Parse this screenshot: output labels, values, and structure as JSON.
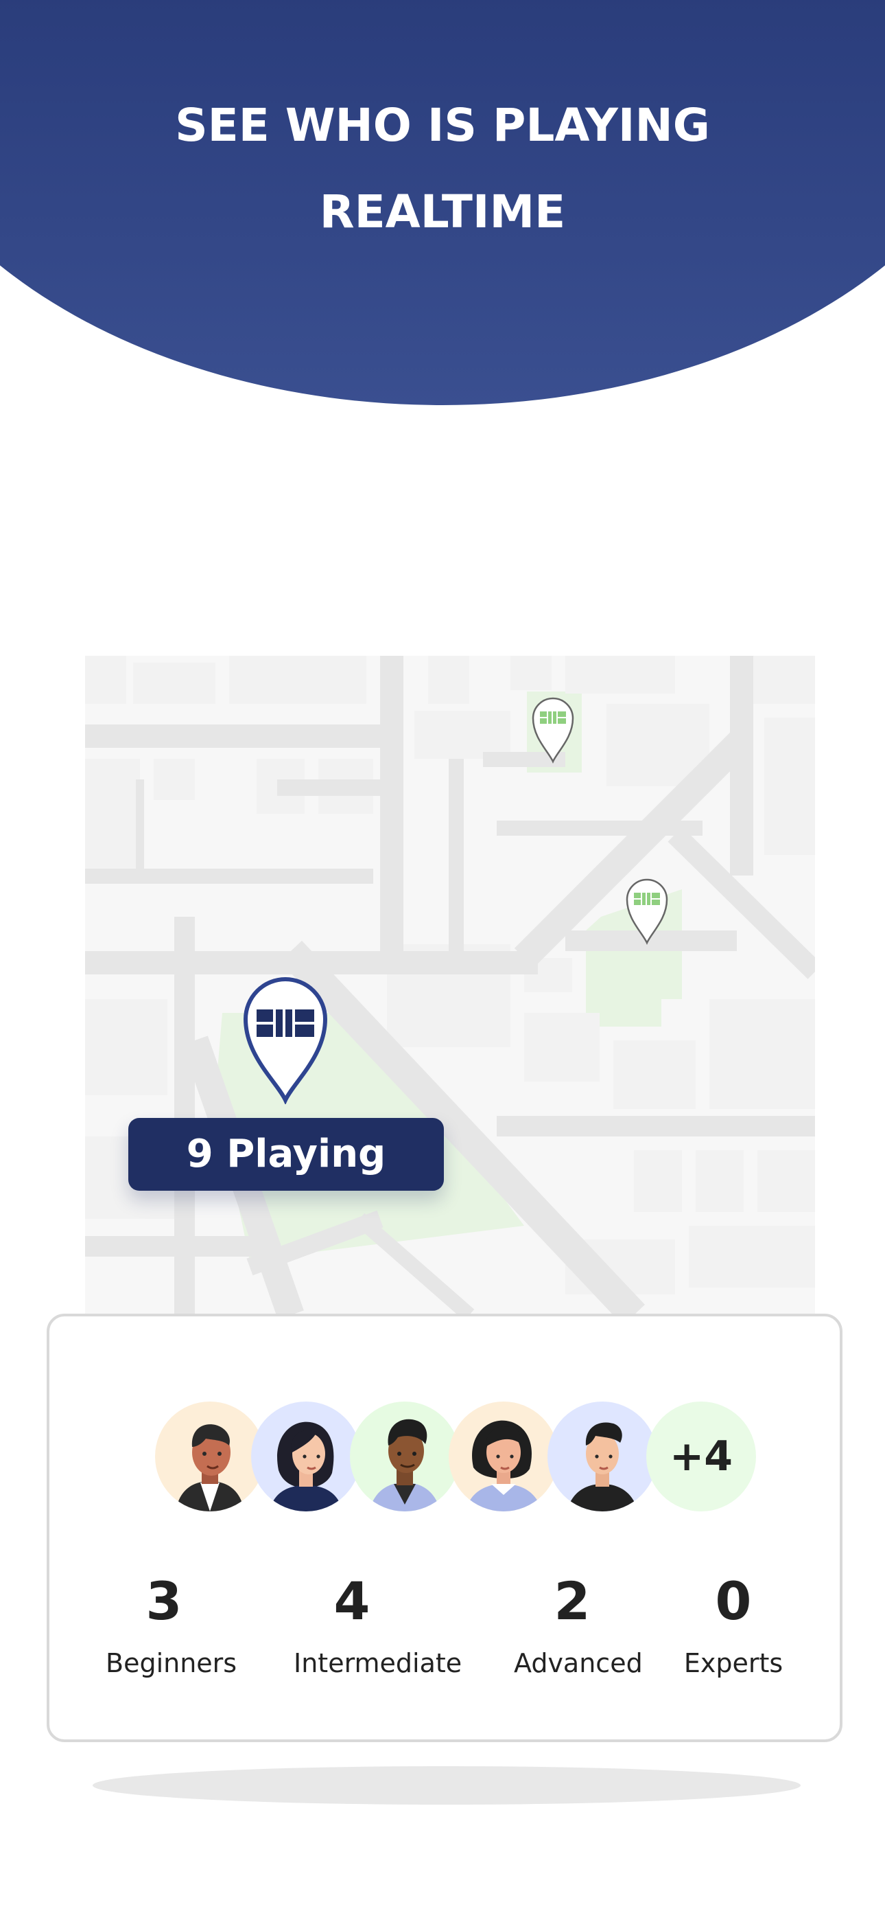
{
  "header": {
    "title_line1": "SEE WHO IS PLAYING",
    "title_line2": "REALTIME"
  },
  "map": {
    "main_marker": {
      "icon": "court-icon",
      "playing_label": "9 Playing"
    },
    "other_markers": [
      {
        "icon": "court-icon"
      },
      {
        "icon": "court-icon"
      }
    ]
  },
  "players_card": {
    "avatars": [
      {
        "name": "avatar-1",
        "background": "#fdeed8"
      },
      {
        "name": "avatar-2",
        "background": "#dfe6ff"
      },
      {
        "name": "avatar-3",
        "background": "#e6fbe2"
      },
      {
        "name": "avatar-4",
        "background": "#fdeed8"
      },
      {
        "name": "avatar-5",
        "background": "#dfe6ff"
      }
    ],
    "more_count": "+4",
    "stats": [
      {
        "value": "3",
        "label": "Beginners"
      },
      {
        "value": "4",
        "label": "Intermediate"
      },
      {
        "value": "2",
        "label": "Advanced"
      },
      {
        "value": "0",
        "label": "Experts"
      }
    ]
  },
  "colors": {
    "brand_navy": "#202f63",
    "court_green": "#8fcf7f",
    "park_green": "#e7f4e2",
    "road": "#e7e7e7"
  }
}
